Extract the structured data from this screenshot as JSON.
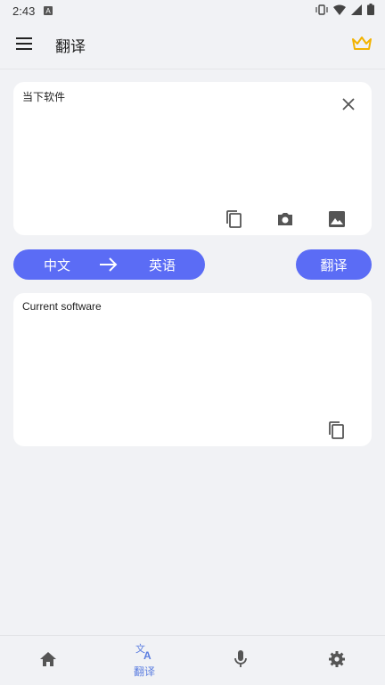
{
  "status": {
    "time": "2:43"
  },
  "appbar": {
    "title": "翻译"
  },
  "input": {
    "text": "当下软件"
  },
  "langs": {
    "source": "中文",
    "target": "英语"
  },
  "actions": {
    "translate_label": "翻译"
  },
  "output": {
    "text": "Current software"
  },
  "nav": {
    "items": [
      {
        "icon": "home-icon",
        "label": ""
      },
      {
        "icon": "translate-icon",
        "label": "翻译",
        "active": true
      },
      {
        "icon": "mic-icon",
        "label": ""
      },
      {
        "icon": "gear-icon",
        "label": ""
      }
    ]
  },
  "colors": {
    "accent": "#5b6cf5",
    "crown": "#f2b300",
    "nav_active": "#5b7de0"
  }
}
